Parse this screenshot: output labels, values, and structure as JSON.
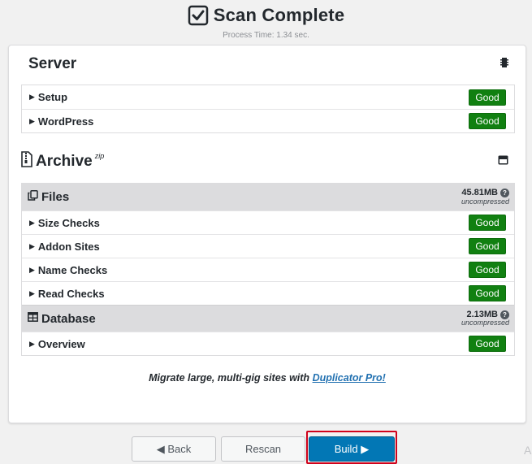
{
  "header": {
    "title": "Scan Complete",
    "process_time": "Process Time: 1.34 sec."
  },
  "server": {
    "title": "Server",
    "items": [
      {
        "label": "Setup",
        "status": "Good"
      },
      {
        "label": "WordPress",
        "status": "Good"
      }
    ]
  },
  "archive": {
    "title": "Archive",
    "suffix": "zip",
    "files": {
      "title": "Files",
      "size": "45.81MB",
      "size_note": "uncompressed",
      "items": [
        {
          "label": "Size Checks",
          "status": "Good"
        },
        {
          "label": "Addon Sites",
          "status": "Good"
        },
        {
          "label": "Name Checks",
          "status": "Good"
        },
        {
          "label": "Read Checks",
          "status": "Good"
        }
      ]
    },
    "database": {
      "title": "Database",
      "size": "2.13MB",
      "size_note": "uncompressed",
      "items": [
        {
          "label": "Overview",
          "status": "Good"
        }
      ]
    }
  },
  "promo": {
    "text": "Migrate large, multi-gig sites with",
    "link": "Duplicator Pro!"
  },
  "footer": {
    "back_label": "◀ Back",
    "rescan_label": "Rescan",
    "build_label": "Build ▶",
    "edge_letter": "A"
  },
  "colors": {
    "good_badge": "#118011",
    "build_button": "#0277b5",
    "highlight": "#d0021b",
    "link": "#2271b1"
  }
}
